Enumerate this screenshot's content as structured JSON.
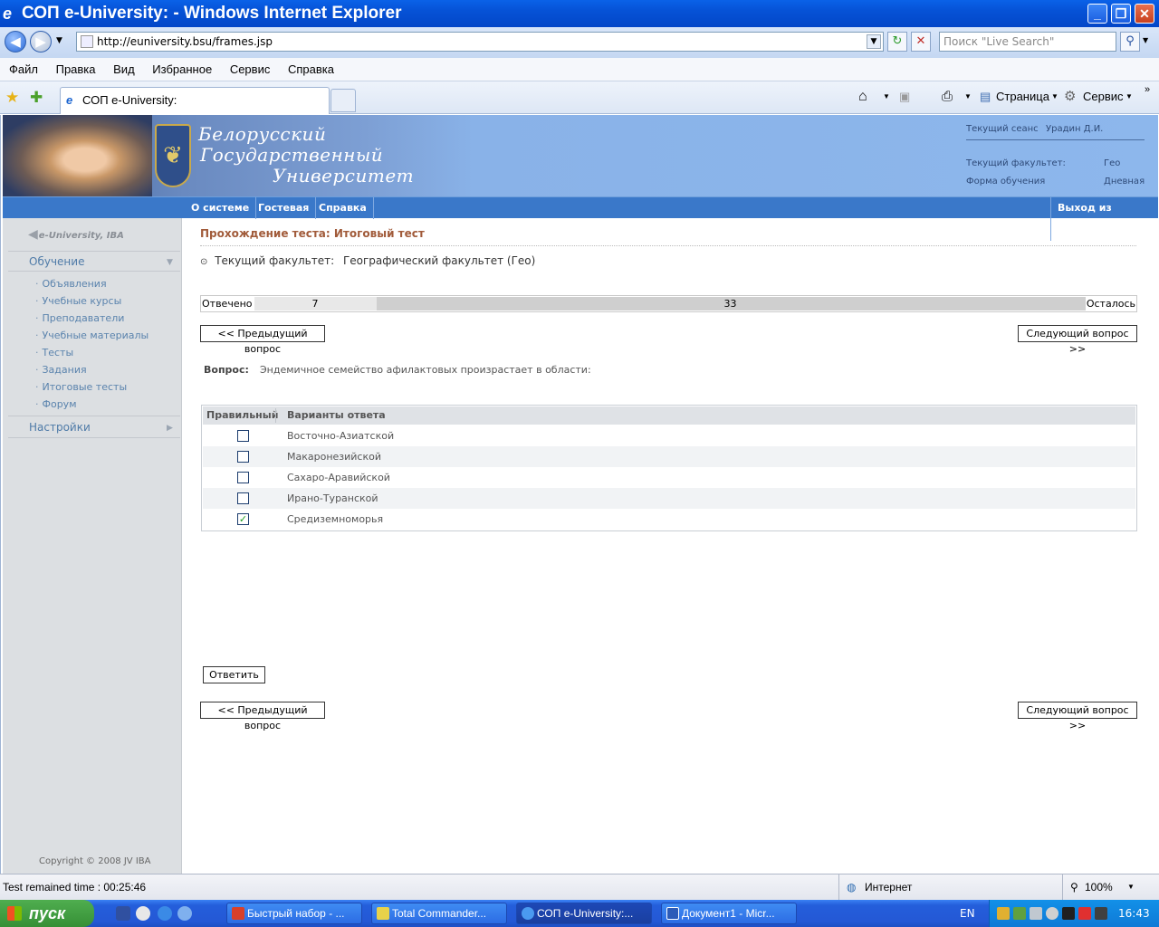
{
  "window": {
    "title": "СОП e-University:  - Windows Internet Explorer"
  },
  "addressbar": {
    "url": "http://euniversity.bsu/frames.jsp",
    "search_placeholder": "Поиск \"Live Search\""
  },
  "menu": [
    "Файл",
    "Правка",
    "Вид",
    "Избранное",
    "Сервис",
    "Справка"
  ],
  "tab": {
    "title": "СОП e-University:"
  },
  "commandbar": {
    "page_label": "Страница",
    "tools_label": "Сервис"
  },
  "banner": {
    "university_line1": "Белорусский",
    "university_line2": "Государственный",
    "university_line3": "Университет",
    "session_label": "Текущий сеанс",
    "session_user": "Урадин Д.И.",
    "faculty_label": "Текущий факультет:",
    "faculty_value": "Гео",
    "form_label": "Форма обучения",
    "form_value": "Дневная"
  },
  "topnav": {
    "items": [
      "О системе",
      "Гостевая",
      "Справка"
    ],
    "logout": "Выход из системы"
  },
  "sidebar": {
    "logo": "e-University, IBA",
    "section1": "Обучение",
    "items": [
      "Объявления",
      "Учебные курсы",
      "Преподаватели",
      "Учебные материалы",
      "Тесты",
      "Задания",
      "Итоговые тесты",
      "Форум"
    ],
    "section2": "Настройки",
    "copyright": "Copyright © 2008 JV IBA"
  },
  "content": {
    "page_title": "Прохождение теста: Итоговый тест",
    "faculty_label": "Текущий факультет:",
    "faculty_value": "Географический факультет (Гео)",
    "progress": {
      "answered_label": "Отвечено",
      "answered": 7,
      "remaining": 33,
      "remaining_label": "Осталось"
    },
    "prev_button": "<< Предыдущий вопрос",
    "next_button": "Следующий вопрос >>",
    "question_label": "Вопрос:",
    "question_text": "Эндемичное семейство афилактовых произрастает в области:",
    "table_headers": [
      "Правильный",
      "Варианты ответа"
    ],
    "answers": [
      {
        "text": "Восточно-Азиатской",
        "checked": false
      },
      {
        "text": "Макаронезийской",
        "checked": false
      },
      {
        "text": "Сахаро-Аравийской",
        "checked": false
      },
      {
        "text": "Ирано-Туранской",
        "checked": false
      },
      {
        "text": "Средиземноморья",
        "checked": true
      }
    ],
    "submit_button": "Ответить"
  },
  "statusbar": {
    "time_text": "Test remained time :  00:25:46",
    "zone": "Интернет",
    "zoom": "100%"
  },
  "taskbar": {
    "start": "пуск",
    "tasks": [
      "Быстрый набор - ...",
      "Total Commander...",
      "СОП e-University:...",
      "Документ1 - Micr..."
    ],
    "lang": "EN",
    "clock": "16:43"
  },
  "colors": {
    "title_bar": "#0652d6",
    "nav_blue": "#3a78c9",
    "page_title": "#a15b3a",
    "sidebar_bg": "#dcdfe2"
  }
}
